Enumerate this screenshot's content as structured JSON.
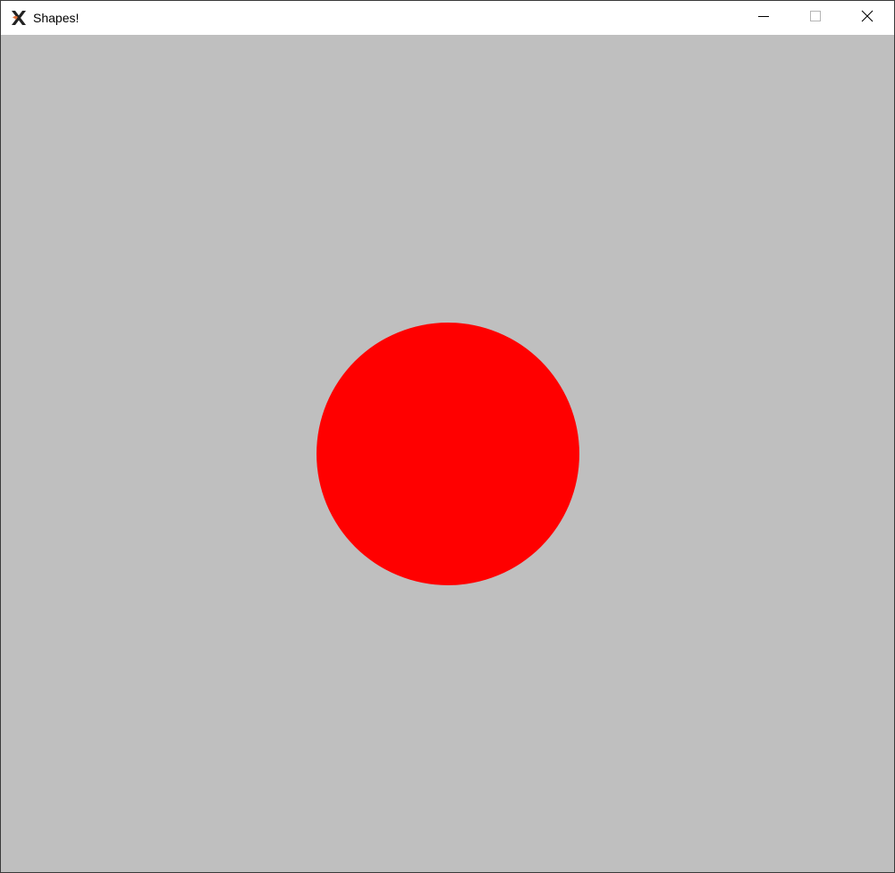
{
  "window": {
    "title": "Shapes!",
    "app_icon": "x-logo-icon",
    "controls": {
      "minimize_icon": "minimize-icon",
      "maximize_icon": "maximize-icon",
      "close_icon": "close-icon"
    }
  },
  "canvas": {
    "background_color": "#bfbfbf",
    "shapes": [
      {
        "type": "circle",
        "fill": "#ff0000"
      }
    ]
  }
}
